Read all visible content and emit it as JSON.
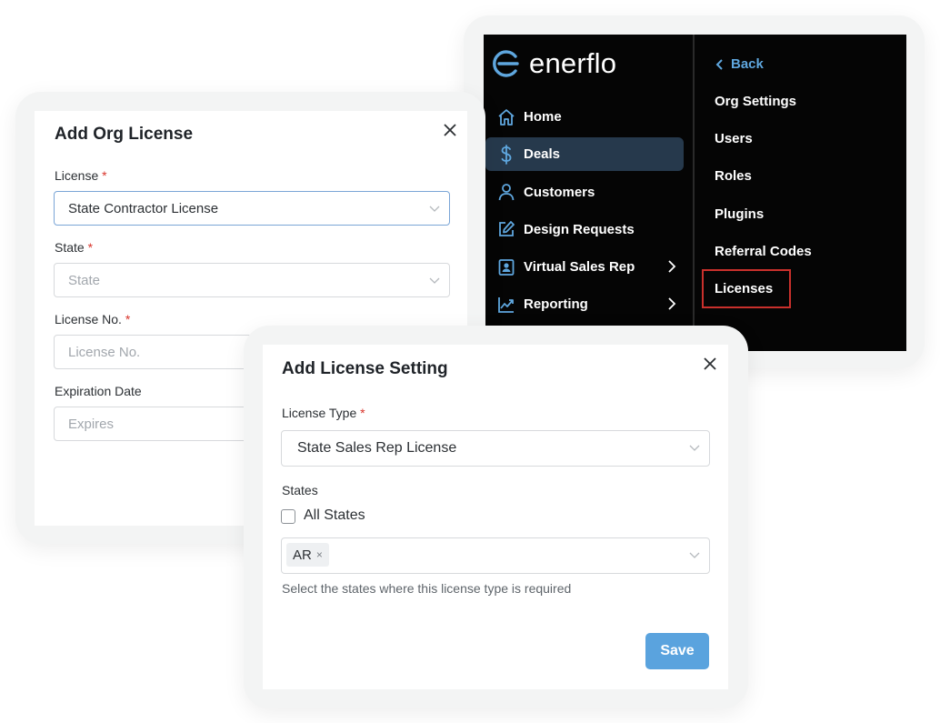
{
  "nav": {
    "brand": "enerflo",
    "items": [
      {
        "label": "Home",
        "icon": "home-icon"
      },
      {
        "label": "Deals",
        "icon": "dollar-icon",
        "active": true
      },
      {
        "label": "Customers",
        "icon": "user-icon"
      },
      {
        "label": "Design Requests",
        "icon": "edit-icon"
      },
      {
        "label": "Virtual Sales Rep",
        "icon": "contact-icon",
        "has_submenu": true
      },
      {
        "label": "Reporting",
        "icon": "chart-icon",
        "has_submenu": true
      }
    ],
    "back_label": "Back",
    "settings_items": [
      "Org Settings",
      "Users",
      "Roles",
      "Plugins",
      "Referral Codes",
      "Licenses"
    ],
    "highlighted_item": "Licenses",
    "colors": {
      "accent": "#5fa7df",
      "active_bg": "#26394c",
      "highlight": "#c9302c"
    }
  },
  "org_license_modal": {
    "title": "Add Org License",
    "license_label": "License",
    "license_value": "State Contractor License",
    "state_label": "State",
    "state_placeholder": "State",
    "license_no_label": "License No.",
    "license_no_placeholder": "License No.",
    "expiration_label": "Expiration Date",
    "expiration_placeholder": "Expires",
    "required_mark": "*"
  },
  "license_setting_modal": {
    "title": "Add License Setting",
    "license_type_label": "License Type",
    "license_type_value": "State Sales Rep License",
    "states_label": "States",
    "all_states_label": "All States",
    "all_states_checked": false,
    "selected_states": [
      "AR"
    ],
    "chip_remove": "×",
    "helper_text": "Select the states where this license type is required",
    "save_label": "Save",
    "required_mark": "*",
    "colors": {
      "save_button": "#5aa3de"
    }
  }
}
